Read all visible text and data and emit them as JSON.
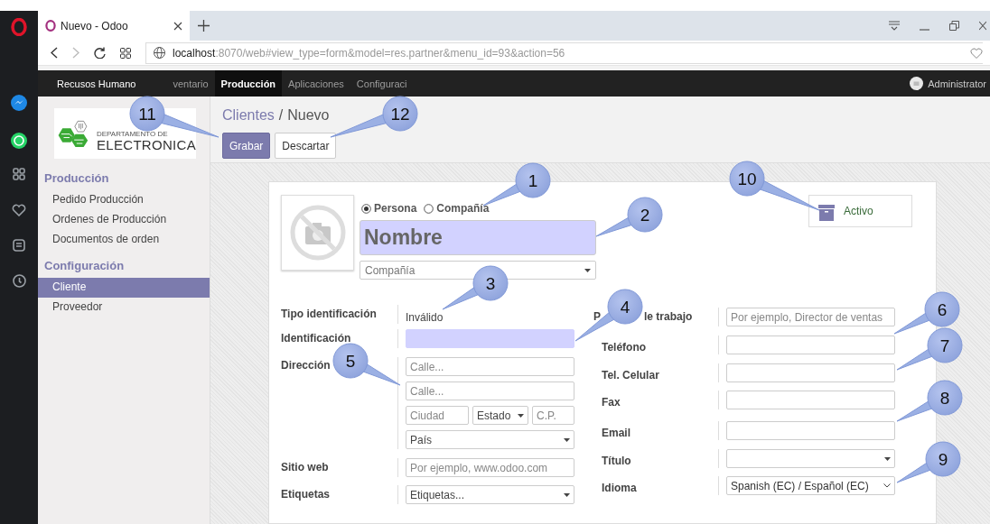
{
  "browser": {
    "tab_title": "Nuevo - Odoo",
    "url_host": "localhost",
    "url_rest": ":8070/web#view_type=form&model=res.partner&menu_id=93&action=56"
  },
  "navbar": {
    "menus": [
      {
        "label": "Recusos Humano",
        "selected": false
      },
      {
        "label": "ventario",
        "selected": false
      },
      {
        "label": "Producción",
        "selected": true
      },
      {
        "label": "Aplicaciones",
        "selected": false
      },
      {
        "label": "Configuraci",
        "selected": false
      }
    ],
    "user": "Administrator"
  },
  "sidebar": {
    "logo_small": "DEPARTAMENTO DE",
    "logo_big": "ELECTRONICA",
    "sections": [
      {
        "title": "Producción",
        "items": [
          {
            "label": "Pedido Producción",
            "selected": false
          },
          {
            "label": "Ordenes de Producción",
            "selected": false
          },
          {
            "label": "Documentos de orden",
            "selected": false
          }
        ]
      },
      {
        "title": "Configuración",
        "items": [
          {
            "label": "Cliente",
            "selected": true
          },
          {
            "label": "Proveedor",
            "selected": false
          }
        ]
      }
    ]
  },
  "breadcrumb": {
    "parent": "Clientes",
    "separator": "/",
    "current": "Nuevo"
  },
  "buttons": [
    {
      "label": "Grabar",
      "kind": "primary"
    },
    {
      "label": "Descartar",
      "kind": "secondary"
    }
  ],
  "form": {
    "company_type": [
      {
        "label": "Persona",
        "selected": true
      },
      {
        "label": "Compañía",
        "selected": false
      }
    ],
    "name_placeholder": "Nombre",
    "company_placeholder": "Compañía",
    "active_button": "Activo",
    "left_fields": [
      {
        "label": "Tipo identificación",
        "kind": "readonly",
        "value": "Inválido"
      },
      {
        "label": "Identificación",
        "kind": "input",
        "required": true
      },
      {
        "label": "Dirección",
        "kind": "address",
        "street_placeholder": "Calle...",
        "street2_placeholder": "Calle...",
        "city_placeholder": "Ciudad",
        "state_placeholder": "Estado",
        "zip_placeholder": "C.P.",
        "country_placeholder": "País"
      },
      {
        "label": "Sitio web",
        "kind": "input",
        "required": false,
        "placeholder": "Por ejemplo, www.odoo.com"
      },
      {
        "label": "Etiquetas",
        "kind": "select",
        "placeholder": "Etiquetas..."
      }
    ],
    "right_fields": [
      {
        "label": "P",
        "label_tail": "le trabajo",
        "kind": "input",
        "placeholder": "Por ejemplo, Director de ventas"
      },
      {
        "label": "Teléfono",
        "kind": "input"
      },
      {
        "label": "Tel. Celular",
        "kind": "input"
      },
      {
        "label": "Fax",
        "kind": "input"
      },
      {
        "label": "Email",
        "kind": "input"
      },
      {
        "label": "Título",
        "kind": "select"
      },
      {
        "label": "Idioma",
        "kind": "native_select",
        "value": "Spanish (EC) / Español (EC)"
      }
    ]
  },
  "callouts": [
    {
      "number": "1"
    },
    {
      "number": "2"
    },
    {
      "number": "3"
    },
    {
      "number": "4"
    },
    {
      "number": "5"
    },
    {
      "number": "6"
    },
    {
      "number": "7"
    },
    {
      "number": "8"
    },
    {
      "number": "9"
    },
    {
      "number": "10"
    },
    {
      "number": "11"
    },
    {
      "number": "12"
    }
  ]
}
